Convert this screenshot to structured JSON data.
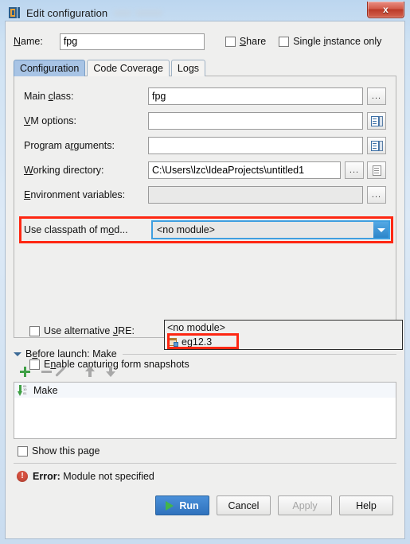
{
  "window": {
    "title": "Edit configuration",
    "app_icon": "intellij-idea-icon",
    "close_label": "x"
  },
  "name_row": {
    "label": "Name:",
    "value": "fpg",
    "share_label": "Share",
    "share_checked": false,
    "single_instance_label": "Single instance only",
    "single_instance_checked": false
  },
  "tabs": [
    {
      "label": "Configuration",
      "active": true
    },
    {
      "label": "Code Coverage",
      "active": false
    },
    {
      "label": "Logs",
      "active": false
    }
  ],
  "fields": {
    "main_class": {
      "label": "Main class:",
      "value": "fpg",
      "browse": "..."
    },
    "vm_options": {
      "label": "VM options:",
      "value": "",
      "expand_icon": "expand-editor-icon"
    },
    "program_arguments": {
      "label": "Program arguments:",
      "value": "",
      "expand_icon": "expand-editor-icon"
    },
    "working_directory": {
      "label": "Working directory:",
      "value": "C:\\Users\\lzc\\IdeaProjects\\untitled1",
      "browse": "...",
      "macro_icon": "macro-list-icon"
    },
    "environment_variables": {
      "label": "Environment variables:",
      "value": "",
      "browse": "..."
    }
  },
  "classpath": {
    "label": "Use classpath of mod...",
    "selected": "<no module>",
    "highlight_color": "#fe2712",
    "dropdown_open": true,
    "options": [
      {
        "label": "<no module>",
        "icon": null,
        "highlighted": false
      },
      {
        "label": "eg12.3",
        "icon": "module-icon",
        "highlighted": true
      }
    ]
  },
  "alt_jre": {
    "label": "Use alternative JRE:",
    "checked": false
  },
  "form_snapshots": {
    "label": "Enable capturing form snapshots",
    "checked": false
  },
  "before_launch": {
    "title": "Before launch: Make",
    "toolbar": [
      {
        "name": "add-button",
        "icon": "plus-icon"
      },
      {
        "name": "remove-button",
        "icon": "minus-icon"
      },
      {
        "name": "edit-button",
        "icon": "pencil-icon"
      },
      {
        "name": "move-up-button",
        "icon": "arrow-up-icon"
      },
      {
        "name": "move-down-button",
        "icon": "arrow-down-icon"
      }
    ],
    "items": [
      {
        "label": "Make",
        "icon": "make-icon"
      }
    ]
  },
  "show_this_page": {
    "label": "Show this page",
    "checked": false
  },
  "error": {
    "icon": "error-icon",
    "prefix": "Error:",
    "message": "Module not specified",
    "color": "#d5503f"
  },
  "buttons": {
    "run": "Run",
    "cancel": "Cancel",
    "apply": "Apply",
    "help": "Help",
    "apply_disabled": true
  }
}
